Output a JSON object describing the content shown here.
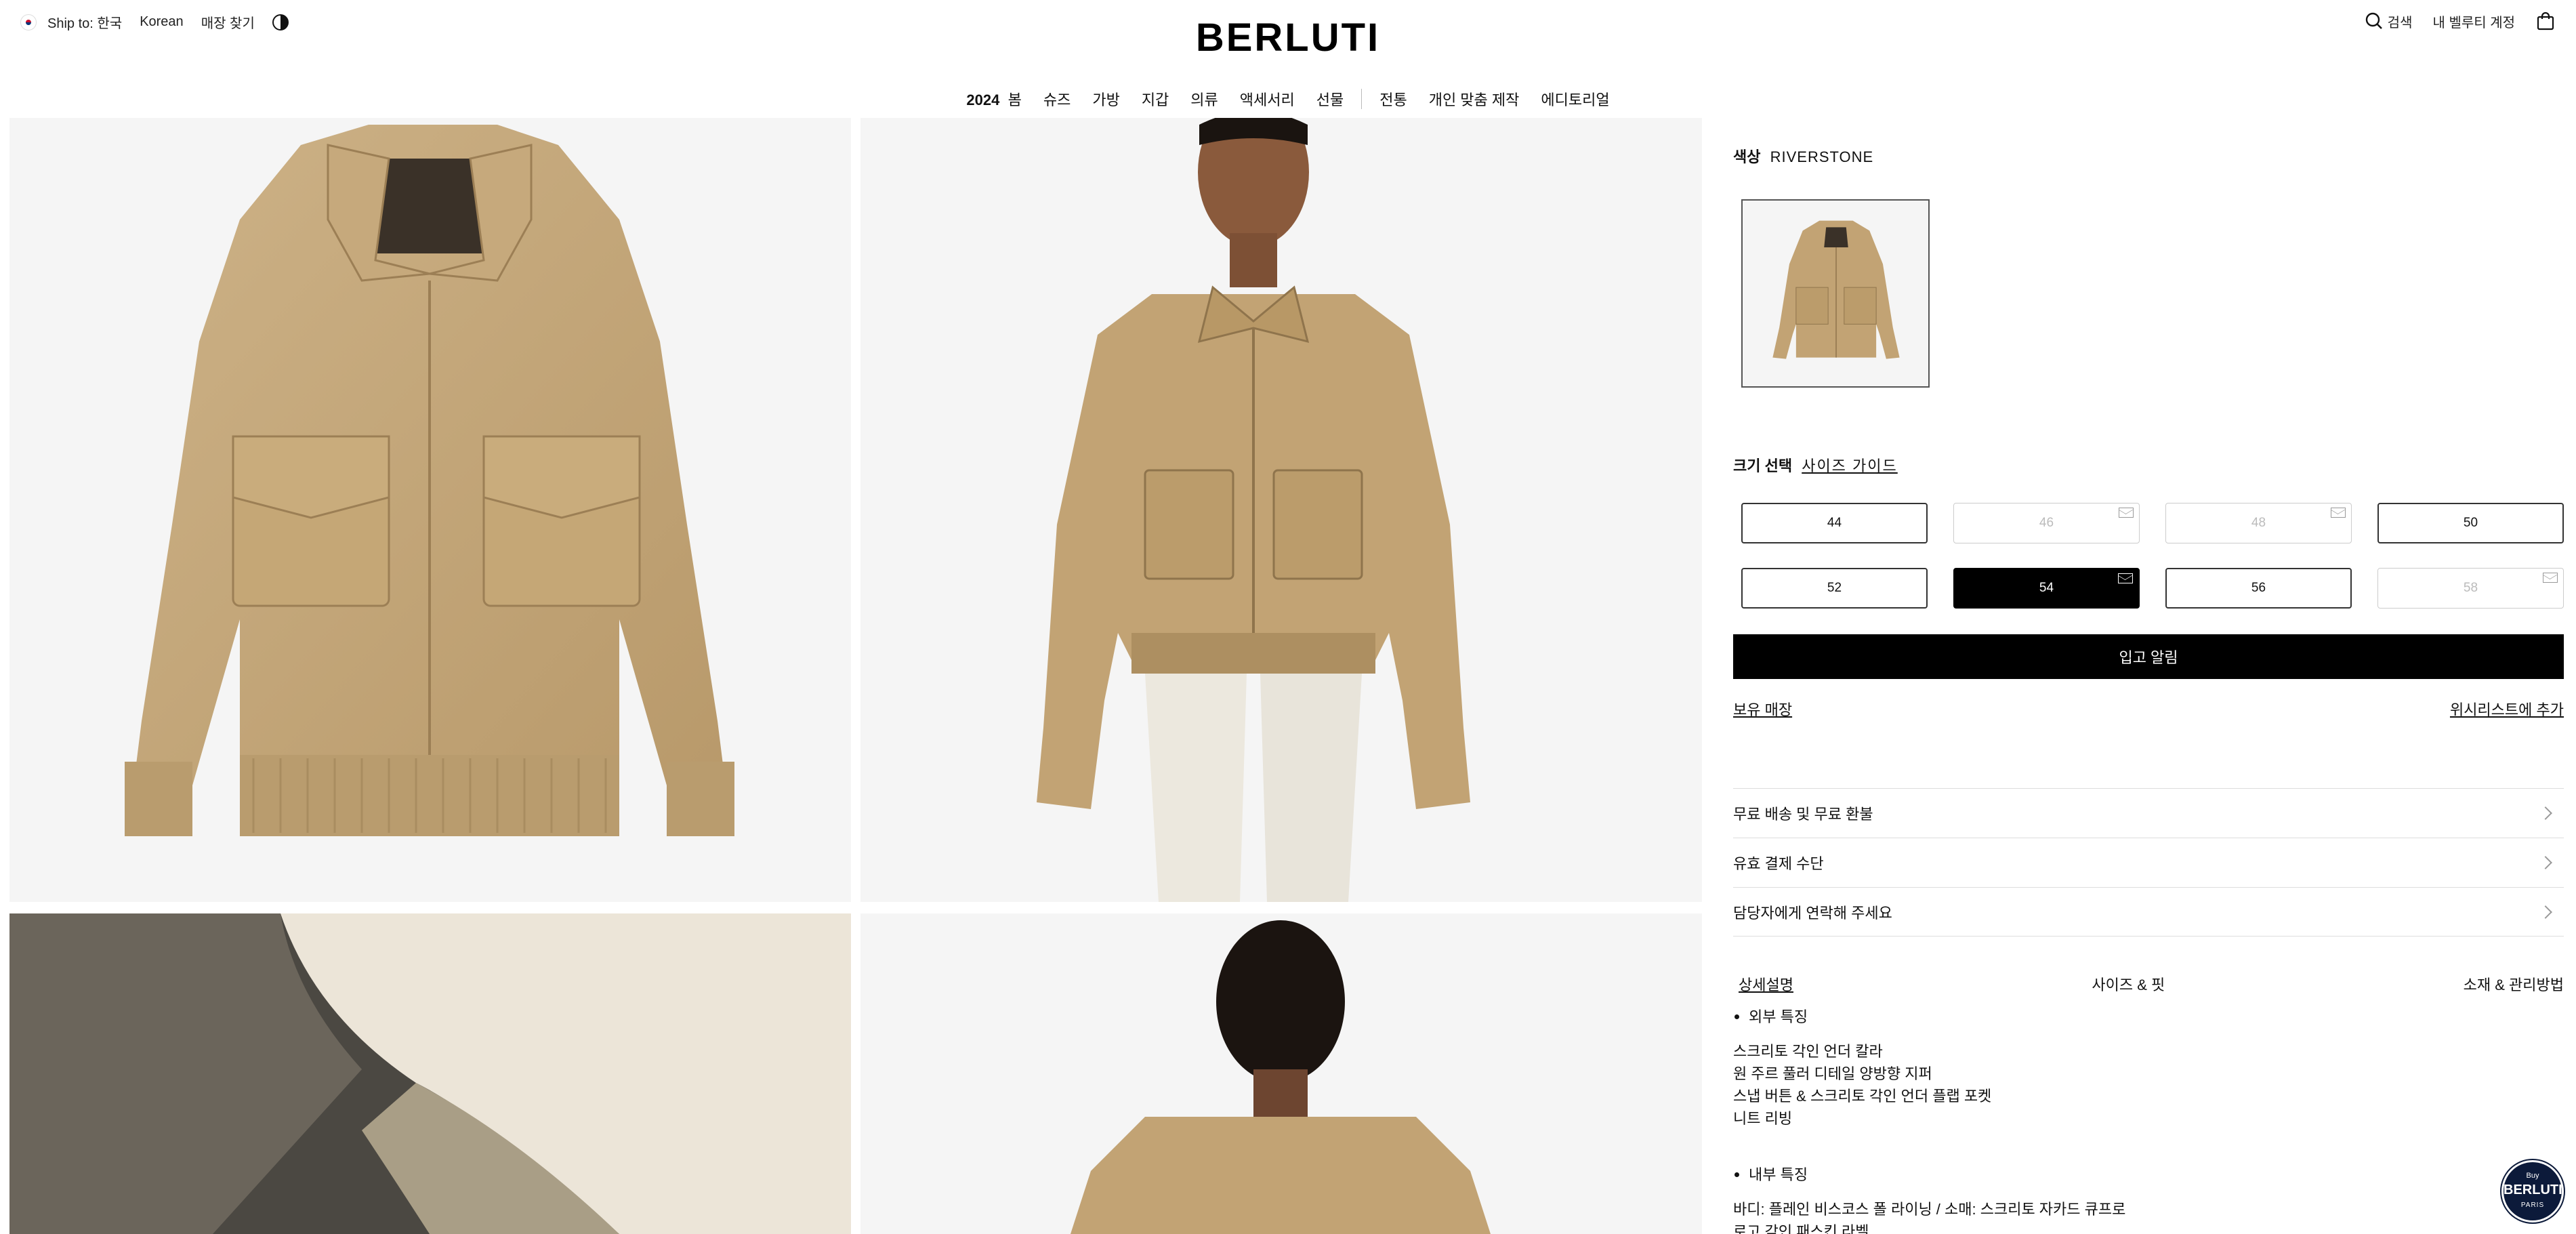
{
  "header": {
    "ship_to": "Ship to: 한국",
    "language": "Korean",
    "store_locator": "매장 찾기",
    "logo": "BERLUTI",
    "search": "검색",
    "account": "내 벨루티 계정"
  },
  "nav": {
    "items": [
      {
        "label_bold": "2024",
        "label": "봄"
      },
      {
        "label": "슈즈"
      },
      {
        "label": "가방"
      },
      {
        "label": "지갑"
      },
      {
        "label": "의류"
      },
      {
        "label": "액세서리"
      },
      {
        "label": "선물"
      }
    ],
    "items_right": [
      {
        "label": "전통"
      },
      {
        "label": "개인 맞춤 제작"
      },
      {
        "label": "에디토리얼"
      }
    ]
  },
  "product": {
    "color_label": "색상",
    "color_value": "RIVERSTONE",
    "size_label": "크기 선택",
    "size_guide": "사이즈 가이드",
    "sizes": [
      {
        "label": "44",
        "state": "available"
      },
      {
        "label": "46",
        "state": "unavailable"
      },
      {
        "label": "48",
        "state": "unavailable"
      },
      {
        "label": "50",
        "state": "available"
      },
      {
        "label": "52",
        "state": "available"
      },
      {
        "label": "54",
        "state": "selected"
      },
      {
        "label": "56",
        "state": "available"
      },
      {
        "label": "58",
        "state": "unavailable"
      }
    ],
    "notify_button": "입고 알림",
    "stores_link": "보유 매장",
    "wishlist_link": "위시리스트에 추가",
    "accordion": [
      "무료 배송 및 무료 환불",
      "유효 결제 수단",
      "담당자에게 연락해 주세요"
    ],
    "tabs": [
      "상세설명",
      "사이즈 & 핏",
      "소재 & 관리방법"
    ],
    "description": {
      "exterior_title": "외부 특징",
      "exterior_lines": [
        "스크리토 각인 언더 칼라",
        "원 주르 풀러 디테일 양방향 지퍼",
        "스냅 버튼 & 스크리토 각인 언더 플랩 포켓",
        "니트 리빙"
      ],
      "interior_title": "내부 특징",
      "interior_lines": [
        "바디: 플레인 비스코스 폴 라이닝 / 소매: 스크리토 자카드 큐프로",
        "로고 각인 패스킨 라벨"
      ]
    }
  },
  "badge": {
    "top": "Buy",
    "brand": "BERLUTI",
    "bottom": "PARIS"
  },
  "colors": {
    "suede": "#c2a678",
    "background": "#f5f5f5",
    "black": "#000000"
  }
}
